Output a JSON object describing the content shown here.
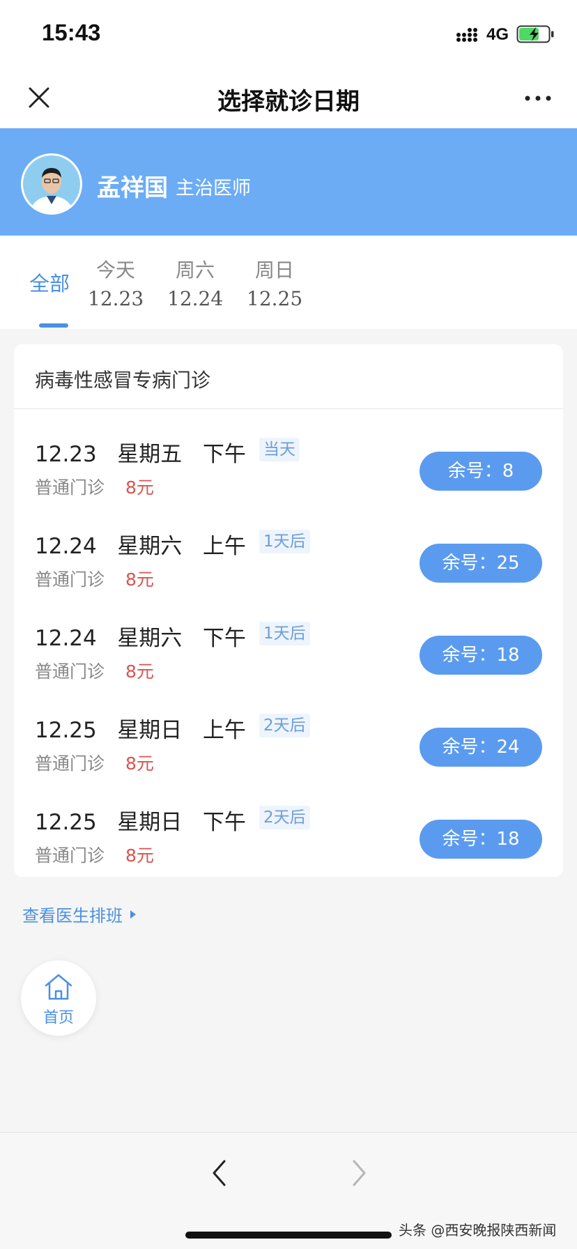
{
  "status_bar": {
    "time": "15:43",
    "network": "4G",
    "icons": [
      "signal-icon",
      "battery-charging-icon"
    ]
  },
  "nav": {
    "title": "选择就诊日期",
    "icons": [
      "close-icon",
      "more-icon"
    ]
  },
  "doctor": {
    "name": "孟祥国",
    "title": "主治医师"
  },
  "tabs": {
    "all": "全部",
    "days": [
      {
        "name": "今天",
        "date": "12.23"
      },
      {
        "name": "周六",
        "date": "12.24"
      },
      {
        "name": "周日",
        "date": "12.25"
      }
    ]
  },
  "clinic": {
    "title": "病毒性感冒专病门诊",
    "slots": [
      {
        "date": "12.23",
        "weekday": "星期五",
        "period": "下午",
        "tag": "当天",
        "type": "普通门诊",
        "price": "8元",
        "remaining": "余号：8"
      },
      {
        "date": "12.24",
        "weekday": "星期六",
        "period": "上午",
        "tag": "1天后",
        "type": "普通门诊",
        "price": "8元",
        "remaining": "余号：25"
      },
      {
        "date": "12.24",
        "weekday": "星期六",
        "period": "下午",
        "tag": "1天后",
        "type": "普通门诊",
        "price": "8元",
        "remaining": "余号：18"
      },
      {
        "date": "12.25",
        "weekday": "星期日",
        "period": "上午",
        "tag": "2天后",
        "type": "普通门诊",
        "price": "8元",
        "remaining": "余号：24"
      },
      {
        "date": "12.25",
        "weekday": "星期日",
        "period": "下午",
        "tag": "2天后",
        "type": "普通门诊",
        "price": "8元",
        "remaining": "余号：18"
      }
    ]
  },
  "schedule_link": "查看医生排班",
  "home": {
    "label": "首页"
  },
  "watermark": "头条 @西安晚报陕西新闻",
  "colors": {
    "header_blue": "#6bacf5",
    "accent_blue": "#4a90e2",
    "button_blue": "#5b9bef",
    "price_red": "#d9534f",
    "tag_bg": "#eef4fc"
  }
}
